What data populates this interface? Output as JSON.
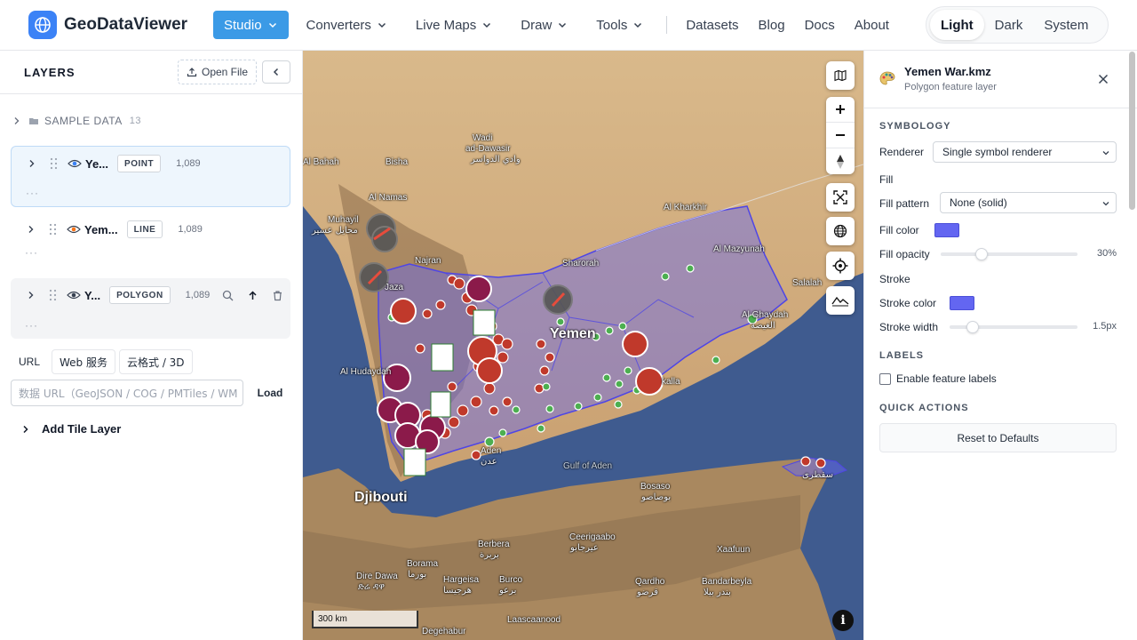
{
  "app": {
    "name": "GeoDataViewer",
    "nav": [
      {
        "label": "Studio",
        "dropdown": true,
        "active": true
      },
      {
        "label": "Converters",
        "dropdown": true
      },
      {
        "label": "Live Maps",
        "dropdown": true
      },
      {
        "label": "Draw",
        "dropdown": true
      },
      {
        "label": "Tools",
        "dropdown": true
      }
    ],
    "links": [
      "Datasets",
      "Blog",
      "Docs",
      "About"
    ],
    "theme": {
      "options": [
        "Light",
        "Dark",
        "System"
      ],
      "selected": "Light"
    }
  },
  "layers_panel": {
    "title": "LAYERS",
    "open_file_label": "Open File",
    "sample_data": {
      "label": "SAMPLE DATA",
      "count": "13"
    },
    "layers": [
      {
        "name": "Ye...",
        "type": "POINT",
        "count": "1,089",
        "dots": "···",
        "selected": true
      },
      {
        "name": "Yem...",
        "type": "LINE",
        "count": "1,089",
        "dots": "···"
      },
      {
        "name": "Y...",
        "type": "POLYGON",
        "count": "1,089",
        "dots": "···"
      }
    ],
    "source_tabs": [
      "URL",
      "Web 服务",
      "云格式 / 3D"
    ],
    "url_placeholder": "数据 URL（GeoJSON / COG / PMTiles / WM",
    "load_label": "Load",
    "add_tile_layer_label": "Add Tile Layer"
  },
  "map": {
    "labels": {
      "wadi": "Wadi",
      "ad_dawasir": "ad-Dawasir",
      "ad_dawasir_ar": "وادي الدواسر",
      "al_bahah": "Al Bahah",
      "bisha": "Bisha",
      "al_namas": "Al Namas",
      "muhayil": "Muhayil",
      "muhayil_ar": "محايل عسير",
      "najran": "Najran",
      "jaza": "Jaza",
      "sharorah": "Sharorah",
      "al_khakhir": "Al Kharkhir",
      "al_mazyunah": "Al Mazyunah",
      "salalah": "Salalah",
      "al_ghaydah": "Al Ghaydah",
      "al_ghaydah_ar": "الغيضة",
      "yemen": "Yemen",
      "al_hudaydah": "Al Hudaydah",
      "mukalla": "kalla",
      "aden": "Aden",
      "aden_ar": "عدن",
      "gulf_of_aden": "Gulf of Aden",
      "djibouti": "Djibouti",
      "bosaso": "Bosaso",
      "bosaso_ar": "بوصاصو",
      "ceerigaabo": "Ceerigaabo",
      "ceerigaabo_ar": "عيرجابو",
      "berbera": "Berbera",
      "berbera_ar": "بربرة",
      "xaafuun": "Xaafuun",
      "dire_dawa": "Dire Dawa",
      "dire_dawa_ar": "ድሬ ዳዋ",
      "borama": "Borama",
      "borama_ar": "بورما",
      "hargeisa": "Hargeisa",
      "hargeisa_ar": "هرجيسا",
      "burco": "Burco",
      "burco_ar": "برعو",
      "qardho": "Qardho",
      "qardho_ar": "قرضو",
      "bandarbeyla": "Bandarbeyla",
      "bandarbeyla_ar": "بندر بيلا",
      "laascaanood": "Laascaanood",
      "degehabur": "Degehabur",
      "socotra_ar": "سقطرى"
    },
    "scale_label": "300 km",
    "info_glyph": "i",
    "polygon_color": "#6366f1",
    "point_color_red": "#c0392b",
    "point_color_green": "#4caf50"
  },
  "properties_panel": {
    "title": "Yemen War.kmz",
    "subtitle": "Polygon feature layer",
    "symbology_heading": "SYMBOLOGY",
    "renderer_label": "Renderer",
    "renderer_value": "Single symbol renderer",
    "fill_heading": "Fill",
    "fill_pattern_label": "Fill pattern",
    "fill_pattern_value": "None (solid)",
    "fill_color_label": "Fill color",
    "fill_color": "#6366f1",
    "fill_opacity_label": "Fill opacity",
    "fill_opacity_value": "30%",
    "fill_opacity_fraction": 0.3,
    "stroke_heading": "Stroke",
    "stroke_color_label": "Stroke color",
    "stroke_color": "#6366f1",
    "stroke_width_label": "Stroke width",
    "stroke_width_value": "1.5px",
    "labels_heading": "LABELS",
    "enable_labels_label": "Enable feature labels",
    "enable_labels_checked": false,
    "quick_actions_heading": "QUICK ACTIONS",
    "reset_label": "Reset to Defaults"
  }
}
